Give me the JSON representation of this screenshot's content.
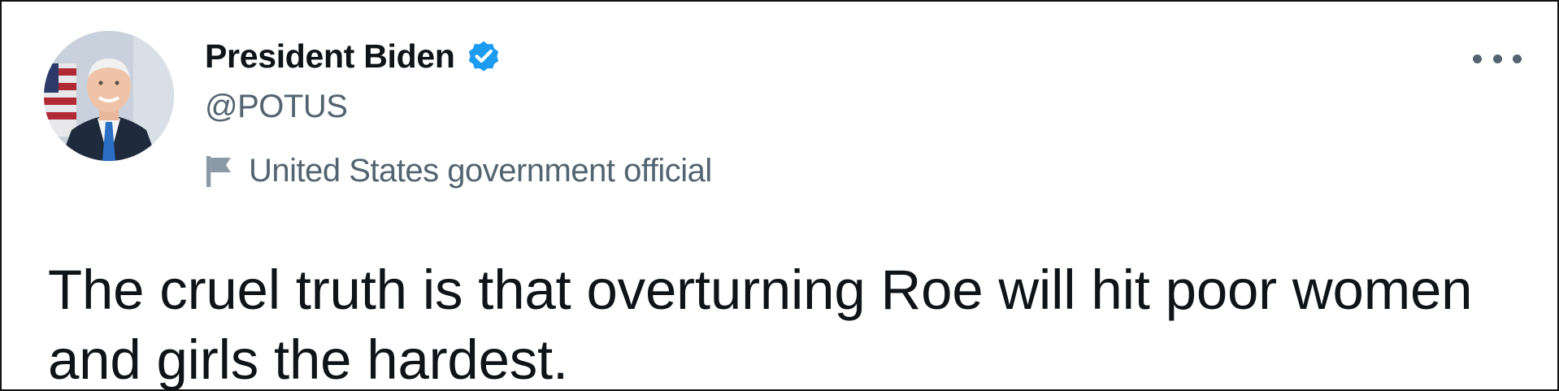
{
  "tweet": {
    "author": {
      "display_name": "President Biden",
      "handle": "@POTUS",
      "verified": true,
      "label": "United States government official",
      "avatar_icon": "avatar-portrait",
      "label_icon": "flag-icon"
    },
    "text": "The cruel truth is that overturning Roe will hit poor women and girls the hardest.",
    "more_icon": "more-dots-icon"
  },
  "colors": {
    "text_primary": "#0f1419",
    "text_secondary": "#536471",
    "verified_blue": "#1d9bf0"
  }
}
